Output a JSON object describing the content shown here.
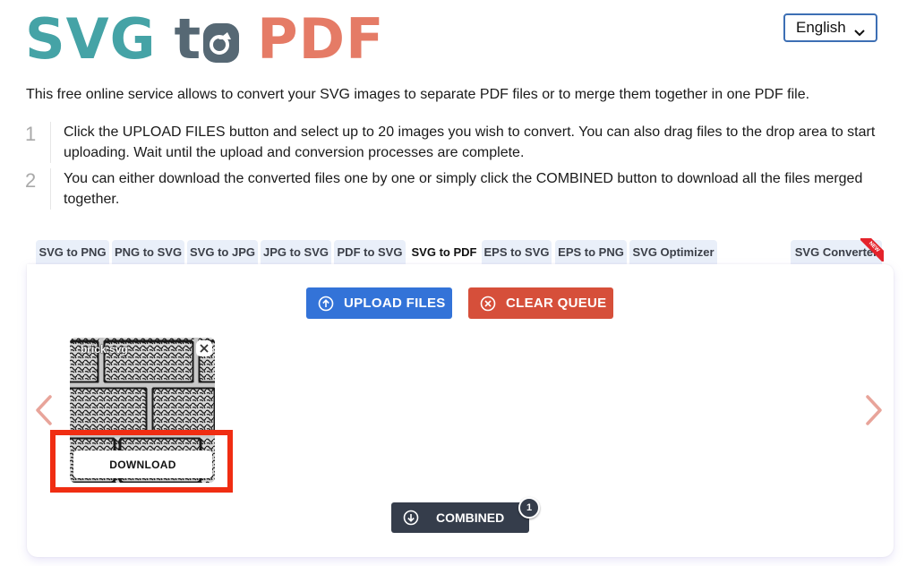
{
  "logo": {
    "part1": "SVG",
    "part2": "t",
    "part3": "PDF",
    "colors": {
      "svg": "#45a3a6",
      "to": "#566874",
      "pdf": "#e57b66"
    }
  },
  "language": {
    "selected": "English",
    "icon": "chevron-down-icon"
  },
  "intro": "This free online service allows to convert your SVG images to separate PDF files or to merge them together in one PDF file.",
  "steps": [
    {
      "number": "1",
      "text": "Click the UPLOAD FILES button and select up to 20 images you wish to convert. You can also drag files to the drop area to start uploading. Wait until the upload and conversion processes are complete."
    },
    {
      "number": "2",
      "text": "You can either download the converted files one by one or simply click the COMBINED button to download all the files merged together."
    }
  ],
  "tabs": [
    {
      "label": "SVG to PNG",
      "active": false
    },
    {
      "label": "PNG to SVG",
      "active": false
    },
    {
      "label": "SVG to JPG",
      "active": false
    },
    {
      "label": "JPG to SVG",
      "active": false
    },
    {
      "label": "PDF to SVG",
      "active": false
    },
    {
      "label": "SVG to PDF",
      "active": true
    },
    {
      "label": "EPS to SVG",
      "active": false
    },
    {
      "label": "EPS to PNG",
      "active": false
    },
    {
      "label": "SVG Optimizer",
      "active": false
    },
    {
      "label": "SVG Converter",
      "active": false,
      "ribbon": "NEW"
    }
  ],
  "toolbar": {
    "upload_label": "UPLOAD FILES",
    "clear_label": "CLEAR QUEUE",
    "upload_color": "#3373d8",
    "clear_color": "#d64f3a"
  },
  "files": [
    {
      "name": "brick.svg",
      "download_label": "DOWNLOAD"
    }
  ],
  "combined": {
    "label": "COMBINED",
    "count": "1"
  },
  "colors": {
    "highlight": "#f02d12",
    "arrow": "#e8a49a",
    "combined_bg": "#353d4b"
  }
}
